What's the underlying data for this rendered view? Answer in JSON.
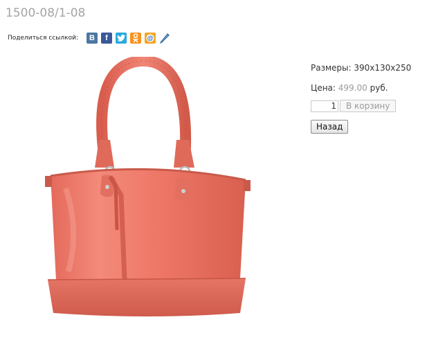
{
  "product": {
    "title": "1500-08/1-08",
    "sizes_label": "Размеры:",
    "sizes_value": "390x130x250",
    "price_label": "Цена:",
    "price_value": "499.00",
    "currency": "руб.",
    "quantity": "1",
    "add_to_cart_label": "В корзину",
    "back_label": "Назад"
  },
  "share": {
    "label": "Поделиться ссылкой:",
    "icons": [
      {
        "name": "vkontakte-icon",
        "glyph": "B",
        "color": "#4d76a1"
      },
      {
        "name": "facebook-icon",
        "glyph": "f",
        "color": "#3b5998"
      },
      {
        "name": "twitter-icon",
        "glyph": "t",
        "color": "#2aa9e0"
      },
      {
        "name": "odnoklassniki-icon",
        "glyph": "ok",
        "color": "#f7931e"
      },
      {
        "name": "mail-ru-icon",
        "glyph": "@",
        "color": "#f5a623"
      },
      {
        "name": "livejournal-icon",
        "glyph": "pencil",
        "color": "#4a7fb5"
      }
    ]
  },
  "image": {
    "subject": "coral patent leather tote handbag",
    "bag_color": "#ef7665"
  }
}
